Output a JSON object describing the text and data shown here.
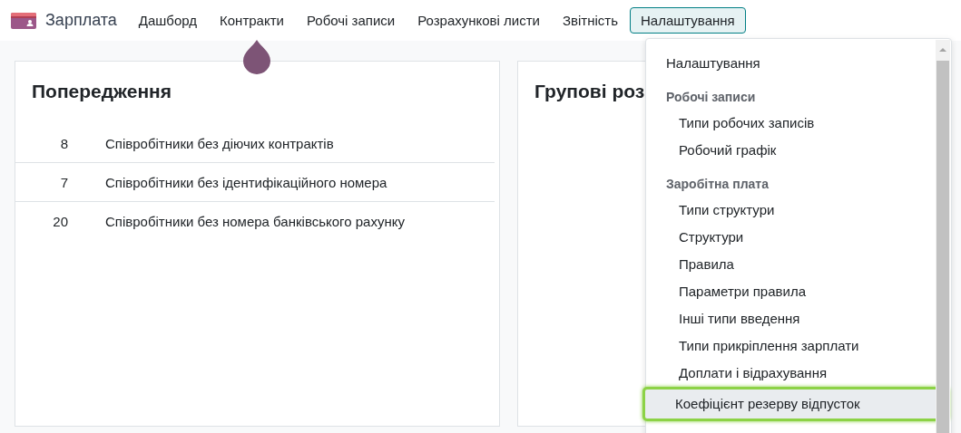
{
  "navbar": {
    "app_name": "Зарплата",
    "items": [
      {
        "label": "Дашборд",
        "selected": false
      },
      {
        "label": "Контракти",
        "selected": false
      },
      {
        "label": "Робочі записи",
        "selected": false
      },
      {
        "label": "Розрахункові листи",
        "selected": false
      },
      {
        "label": "Звітність",
        "selected": false
      },
      {
        "label": "Налаштування",
        "selected": true
      }
    ]
  },
  "warnings": {
    "title": "Попередження",
    "rows": [
      {
        "count": "8",
        "label": "Співробітники без діючих контрактів"
      },
      {
        "count": "7",
        "label": "Співробітники без ідентифікаційного номера"
      },
      {
        "count": "20",
        "label": "Співробітники без номера банківського рахунку"
      }
    ]
  },
  "batches": {
    "title": "Групові роз"
  },
  "menu": {
    "entries": [
      {
        "kind": "item",
        "label": "Налаштування",
        "selected": false
      },
      {
        "kind": "section",
        "label": "Робочі записи"
      },
      {
        "kind": "subitem",
        "label": "Типи робочих записів",
        "selected": false
      },
      {
        "kind": "subitem",
        "label": "Робочий графік",
        "selected": false
      },
      {
        "kind": "section",
        "label": "Заробітна плата"
      },
      {
        "kind": "subitem",
        "label": "Типи структури",
        "selected": false
      },
      {
        "kind": "subitem",
        "label": "Структури",
        "selected": false
      },
      {
        "kind": "subitem",
        "label": "Правила",
        "selected": false
      },
      {
        "kind": "subitem",
        "label": "Параметри правила",
        "selected": false
      },
      {
        "kind": "subitem",
        "label": "Інші типи введення",
        "selected": false
      },
      {
        "kind": "subitem",
        "label": "Типи прикріплення зарплати",
        "selected": false
      },
      {
        "kind": "subitem",
        "label": "Доплати і відрахування",
        "selected": false
      },
      {
        "kind": "subitem",
        "label": "Коефіцієнт резерву відпусток",
        "selected": true
      }
    ]
  }
}
